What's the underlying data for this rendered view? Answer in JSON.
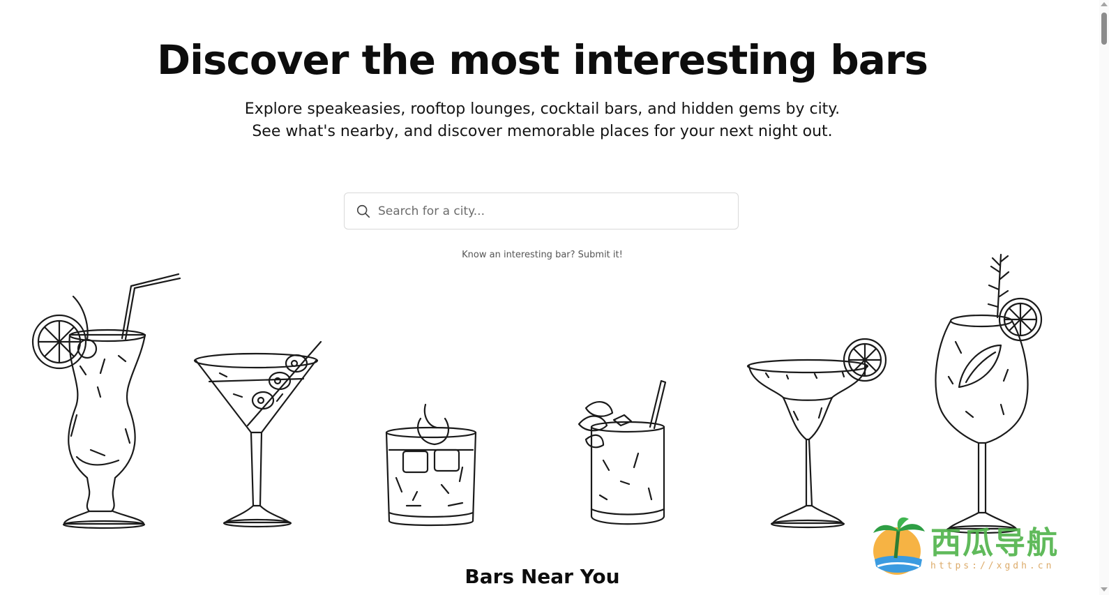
{
  "hero": {
    "title": "Discover the most interesting bars",
    "subtitle_line1": "Explore speakeasies, rooftop lounges, cocktail bars, and hidden gems by city.",
    "subtitle_line2": "See what's nearby, and discover memorable places for your next night out."
  },
  "search": {
    "placeholder": "Search for a city...",
    "value": "",
    "icon": "search-icon"
  },
  "submit_link": "Know an interesting bar? Submit it!",
  "illustrations": [
    "hurricane-cocktail-icon",
    "martini-with-olives-icon",
    "old-fashioned-rocks-glass-icon",
    "mojito-highball-icon",
    "margarita-with-lime-icon",
    "spritz-wine-glass-icon"
  ],
  "section": {
    "title": "Bars Near You"
  },
  "watermark": {
    "text": "西瓜导航",
    "url": "https://xgdh.cn"
  },
  "colors": {
    "text": "#0d0d0d",
    "border": "#d9d9d9",
    "link": "#555555",
    "watermark_green": "#4fb34a"
  }
}
